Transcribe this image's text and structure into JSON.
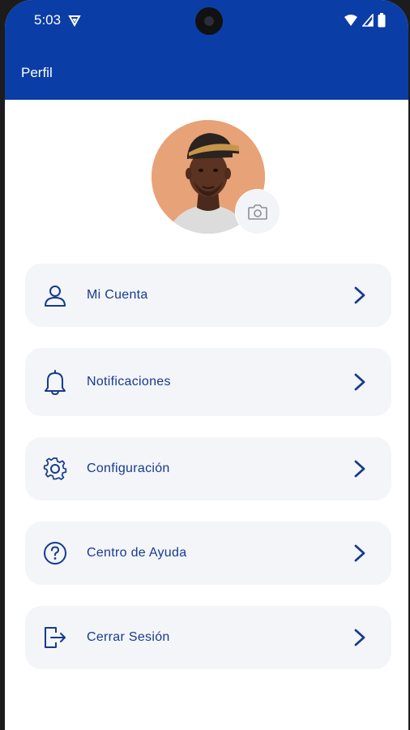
{
  "status_bar": {
    "time": "5:03"
  },
  "appbar": {
    "title": "Perfil"
  },
  "profile": {
    "avatar_alt": "avatar",
    "camera_icon": "camera-icon"
  },
  "menu": {
    "items": [
      {
        "label": "Mi Cuenta",
        "icon": "user-icon"
      },
      {
        "label": "Notificaciones",
        "icon": "bell-icon"
      },
      {
        "label": "Configuración",
        "icon": "gear-icon"
      },
      {
        "label": "Centro de Ayuda",
        "icon": "help-icon"
      },
      {
        "label": "Cerrar Sesión",
        "icon": "logout-icon"
      }
    ]
  },
  "colors": {
    "primary": "#0a3da6",
    "card": "#f3f5f9",
    "text": "#173a8c"
  }
}
